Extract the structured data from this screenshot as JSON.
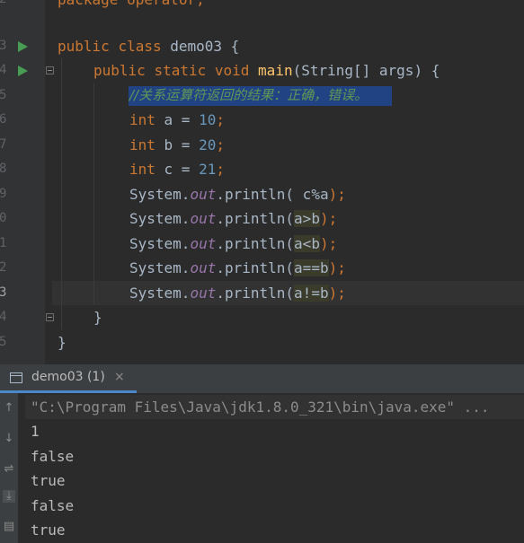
{
  "editor": {
    "line_numbers": [
      "2",
      "3",
      "4",
      "5",
      "6",
      "7",
      "8",
      "9",
      "0",
      "1",
      "2",
      "3",
      "4",
      "5"
    ],
    "lines": {
      "package": "package operator;",
      "class_decl_kw1": "public",
      "class_decl_kw2": "class",
      "class_name": "demo03",
      "class_brace": " {",
      "main_kw1": "public",
      "main_kw2": "static",
      "main_kw3": "void",
      "main_name": "main",
      "main_params": "(String[] args) {",
      "comment": "//关系运算符返回的结果：正确，错误。",
      "decl_a_type": "int",
      "decl_a_name": " a = ",
      "decl_a_val": "10",
      "decl_b_type": "int",
      "decl_b_name": " b = ",
      "decl_b_val": "20",
      "decl_c_type": "int",
      "decl_c_name": " c = ",
      "decl_c_val": "21",
      "semi": ";",
      "sys": "System.",
      "out": "out",
      "println": ".println(",
      "arg1": " c%a",
      "arg2": "a>b",
      "arg3": "a<b",
      "arg4": "a==b",
      "arg5": "a!=b",
      "close": ");",
      "inner_brace": "}",
      "outer_brace": "}"
    }
  },
  "run_tab": {
    "label": "demo03 (1)",
    "close": "×"
  },
  "console": {
    "command": "\"C:\\Program Files\\Java\\jdk1.8.0_321\\bin\\java.exe\" ...",
    "output": [
      "1",
      "false",
      "true",
      "false",
      "true"
    ]
  },
  "colors": {
    "keyword": "#cc7832",
    "number": "#6897bb",
    "method": "#ffc66d",
    "static_field": "#9876aa",
    "comment_selected_bg": "#214283",
    "run_icon": "#499c54"
  }
}
